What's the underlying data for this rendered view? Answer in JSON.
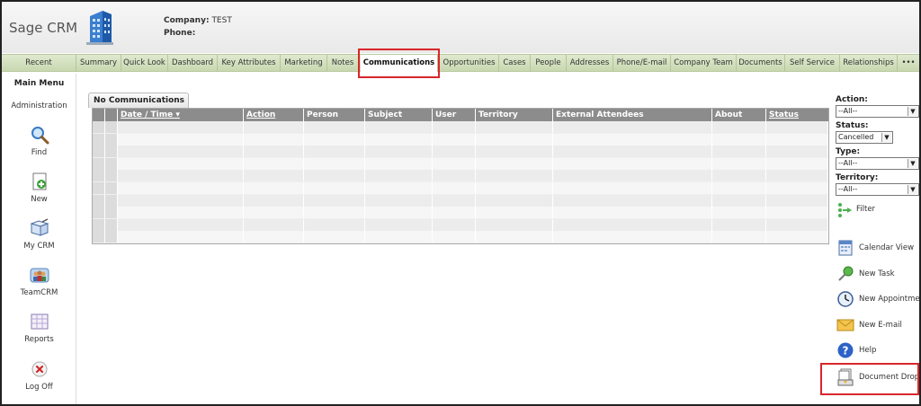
{
  "app": {
    "title": "Sage CRM"
  },
  "context": {
    "company_label": "Company:",
    "company_value": "TEST",
    "phone_label": "Phone:",
    "phone_value": ""
  },
  "tabs": [
    {
      "label": "Recent"
    },
    {
      "label": "Summary"
    },
    {
      "label": "Quick Look"
    },
    {
      "label": "Dashboard"
    },
    {
      "label": "Key Attributes"
    },
    {
      "label": "Marketing"
    },
    {
      "label": "Notes"
    },
    {
      "label": "Communications",
      "active": true
    },
    {
      "label": "Opportunities"
    },
    {
      "label": "Cases"
    },
    {
      "label": "People"
    },
    {
      "label": "Addresses"
    },
    {
      "label": "Phone/E-mail"
    },
    {
      "label": "Company Team"
    },
    {
      "label": "Documents"
    },
    {
      "label": "Self Service"
    },
    {
      "label": "Relationships"
    },
    {
      "label": "•••"
    }
  ],
  "left_menu": {
    "title": "Main Menu",
    "administration": "Administration",
    "items": [
      {
        "label": "Find",
        "icon": "magnifier-icon"
      },
      {
        "label": "New",
        "icon": "new-document-icon"
      },
      {
        "label": "My CRM",
        "icon": "my-crm-icon"
      },
      {
        "label": "TeamCRM",
        "icon": "team-icon"
      },
      {
        "label": "Reports",
        "icon": "reports-icon"
      },
      {
        "label": "Log Off",
        "icon": "log-off-icon"
      }
    ]
  },
  "grid": {
    "tab_title": "No Communications",
    "columns": [
      {
        "label": "",
        "link": false
      },
      {
        "label": "",
        "link": false
      },
      {
        "label": "Date / Time ▾",
        "link": true
      },
      {
        "label": "Action",
        "link": true
      },
      {
        "label": "Person",
        "link": false
      },
      {
        "label": "Subject",
        "link": false
      },
      {
        "label": "User",
        "link": false
      },
      {
        "label": "Territory",
        "link": false
      },
      {
        "label": "External Attendees",
        "link": false
      },
      {
        "label": "About",
        "link": false
      },
      {
        "label": "Status",
        "link": true
      }
    ]
  },
  "filters": {
    "action_label": "Action:",
    "action_value": "--All--",
    "status_label": "Status:",
    "status_value": "Cancelled",
    "type_label": "Type:",
    "type_value": "--All--",
    "territory_label": "Territory:",
    "territory_value": "--All--",
    "filter_button": "Filter"
  },
  "actions": [
    {
      "label": "Calendar View",
      "icon": "calendar-icon"
    },
    {
      "label": "New Task",
      "icon": "pushpin-icon"
    },
    {
      "label": "New Appointment",
      "icon": "clock-icon"
    },
    {
      "label": "New E-mail",
      "icon": "envelope-icon"
    },
    {
      "label": "Help",
      "icon": "help-icon"
    },
    {
      "label": "Document Drop",
      "icon": "document-drop-icon"
    }
  ],
  "colors": {
    "tabbar": "#c9d8b0",
    "highlight": "#d9262b",
    "grid_header": "#8c8c8c"
  }
}
